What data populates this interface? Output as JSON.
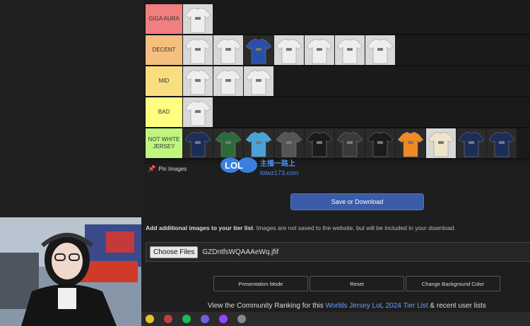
{
  "tiers": [
    {
      "label": "GIGA AURA",
      "color": "#f07f7f",
      "items": [
        "white"
      ]
    },
    {
      "label": "DECENT",
      "color": "#f5bf7f",
      "items": [
        "white",
        "white",
        "blue",
        "white",
        "white",
        "white",
        "white"
      ]
    },
    {
      "label": "MID",
      "color": "#f8de7f",
      "items": [
        "white",
        "white",
        "white"
      ]
    },
    {
      "label": "BAD",
      "color": "#ffff7f",
      "items": [
        "white"
      ]
    },
    {
      "label": "NOT WHITE JERSEY",
      "color": "#bff67f",
      "items": [
        "navy",
        "green",
        "lightblue",
        "gray",
        "black",
        "darkgray",
        "black",
        "orange",
        "cream",
        "navy",
        "navy"
      ]
    }
  ],
  "jersey_colors": {
    "white": "#eeeeee",
    "blue": "#2a4fa8",
    "navy": "#1c2d5a",
    "green": "#2b6b3a",
    "lightblue": "#4aa3d8",
    "gray": "#555555",
    "black": "#1b1b1b",
    "darkgray": "#3a3a3a",
    "orange": "#f08a22",
    "cream": "#efe5c8"
  },
  "pin_label": "Pin Images",
  "watermark": {
    "logo": "LOL",
    "cn": "主播一路上",
    "site": "lolwz173.com"
  },
  "save_button": "Save or Download",
  "add_images": {
    "bold": "Add additional images to your tier list",
    "rest": ". Images are not saved to the website, but will be included in your download."
  },
  "file_input": {
    "button": "Choose Files",
    "filename": "GZDntfsWQAAAeWq.jfif"
  },
  "buttons": {
    "presentation": "Presentation Mode",
    "reset": "Reset",
    "background": "Change Background Color"
  },
  "community": {
    "prefix": "View the Community Ranking for this",
    "link": "Worlds Jersey LoL 2024 Tier List",
    "suffix": "& recent user lists"
  }
}
